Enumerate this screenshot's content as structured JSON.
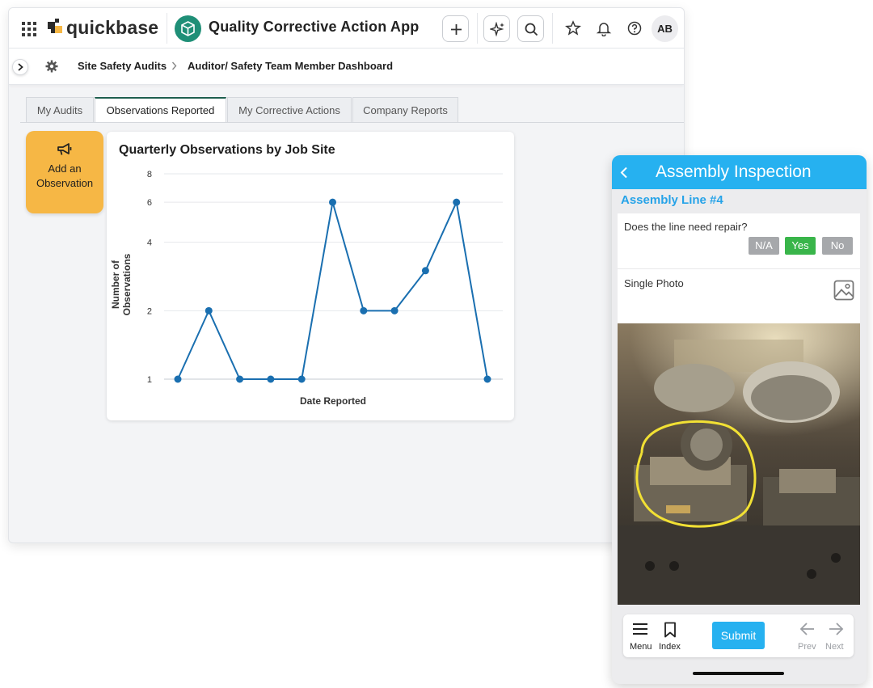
{
  "brand": {
    "name": "quickbase"
  },
  "app": {
    "title": "Quality Corrective Action App"
  },
  "user": {
    "initials": "AB"
  },
  "breadcrumb": {
    "items": [
      "Site Safety Audits",
      "Auditor/ Safety Team Member Dashboard"
    ]
  },
  "tabs": [
    {
      "label": "My Audits",
      "active": false
    },
    {
      "label": "Observations Reported",
      "active": true
    },
    {
      "label": "My Corrective Actions",
      "active": false
    },
    {
      "label": "Company Reports",
      "active": false
    }
  ],
  "add_button": {
    "line1": "Add an",
    "line2": "Observation"
  },
  "colors": {
    "accent": "#1f8f77",
    "line": "#1a6fb0",
    "add_button": "#f6b745",
    "mobile_header": "#26b1f0",
    "yes_selected": "#39b54a",
    "option_default": "#a6a8ab"
  },
  "chart_data": {
    "type": "line",
    "title": "Quarterly Observations by Job Site",
    "xlabel": "Date Reported",
    "ylabel": "Number of Observations",
    "y_scale": "log",
    "yticks": [
      1,
      2,
      4,
      6,
      8
    ],
    "ylim": [
      1,
      8
    ],
    "x": [
      1,
      2,
      3,
      4,
      5,
      6,
      7,
      8,
      9,
      10,
      11
    ],
    "series": [
      {
        "values": [
          1,
          2,
          1,
          1,
          1,
          6,
          2,
          2,
          3,
          6,
          1
        ]
      }
    ],
    "grid": true,
    "legend": "none"
  },
  "mobile": {
    "title": "Assembly Inspection",
    "subtitle": "Assembly Line #4",
    "question": "Does the line need repair?",
    "options": [
      {
        "label": "N/A",
        "selected": false
      },
      {
        "label": "Yes",
        "selected": true
      },
      {
        "label": "No",
        "selected": false
      }
    ],
    "photo_label": "Single Photo",
    "footer": {
      "menu": "Menu",
      "index": "Index",
      "submit": "Submit",
      "prev": "Prev",
      "next": "Next"
    }
  }
}
